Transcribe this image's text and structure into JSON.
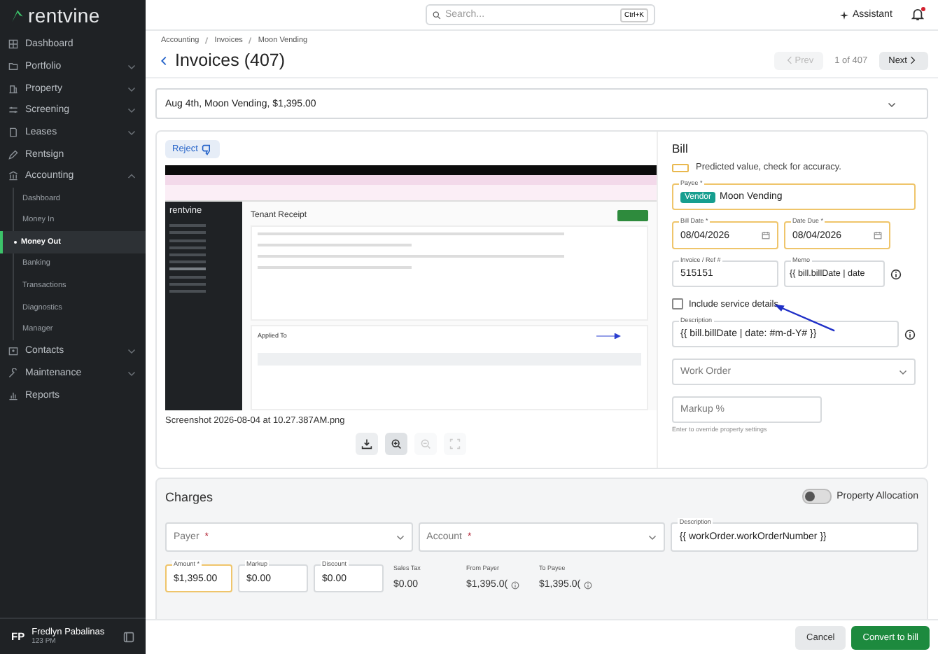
{
  "brand": {
    "name": "rentvine"
  },
  "sidebar": {
    "items": [
      {
        "label": "Dashboard",
        "kind": "link"
      },
      {
        "label": "Portfolio",
        "kind": "group",
        "expanded": false
      },
      {
        "label": "Property",
        "kind": "group",
        "expanded": false
      },
      {
        "label": "Screening",
        "kind": "group",
        "expanded": false
      },
      {
        "label": "Leases",
        "kind": "group",
        "expanded": false
      },
      {
        "label": "Rentsign",
        "kind": "link"
      },
      {
        "label": "Accounting",
        "kind": "group",
        "expanded": true,
        "children": [
          {
            "label": "Dashboard",
            "selected": false
          },
          {
            "label": "Money In",
            "selected": false
          },
          {
            "label": "Money Out",
            "selected": true
          },
          {
            "label": "Banking",
            "selected": false
          },
          {
            "label": "Transactions",
            "selected": false
          },
          {
            "label": "Diagnostics",
            "selected": false
          },
          {
            "label": "Manager",
            "selected": false
          }
        ]
      },
      {
        "label": "Contacts",
        "kind": "group",
        "expanded": false
      },
      {
        "label": "Maintenance",
        "kind": "group",
        "expanded": false
      },
      {
        "label": "Reports",
        "kind": "link"
      }
    ]
  },
  "user": {
    "initials": "FP",
    "name": "Fredlyn Pabalinas",
    "time": "123 PM"
  },
  "topbar": {
    "search_placeholder": "Search...",
    "shortcut": "Ctrl+K",
    "assistant": "Assistant",
    "notification": true
  },
  "breadcrumbs": [
    "Accounting",
    "Invoices",
    "Moon Vending"
  ],
  "page": {
    "title": "Invoices (407)",
    "prev": {
      "label": "Prev",
      "disabled": true
    },
    "counter": "1 of 407",
    "next": {
      "label": "Next",
      "disabled": false
    }
  },
  "invoice_select": {
    "value": "Aug 4th, Moon Vending, $1,395.00"
  },
  "attachment": {
    "reject": "Reject",
    "filename": "Screenshot 2026-08-04 at 10.27.387AM.png",
    "preview": {
      "logo": "rentvine",
      "title": "Tenant Receipt",
      "section": "Applied To"
    },
    "tools": [
      {
        "kind": "download",
        "disabled": false
      },
      {
        "kind": "zoom-in",
        "disabled": false
      },
      {
        "kind": "zoom-out",
        "disabled": true
      },
      {
        "kind": "fullscreen",
        "disabled": true
      }
    ]
  },
  "bill": {
    "title": "Bill",
    "legend": "Predicted value, check for accuracy.",
    "payee": {
      "label": "Payee *",
      "tag": "Vendor",
      "value": "Moon Vending",
      "predicted": true
    },
    "bill_date": {
      "label": "Bill Date *",
      "value": "08/04/2026",
      "predicted": true
    },
    "date_due": {
      "label": "Date Due *",
      "value": "08/04/2026",
      "predicted": true
    },
    "invoice_ref": {
      "label": "Invoice / Ref #",
      "value": "515151",
      "predicted": false
    },
    "memo": {
      "label": "Memo",
      "value": "{{ bill.billDate | date",
      "predicted": false
    },
    "include_service": {
      "label": "Include service details",
      "checked": false
    },
    "description": {
      "label": "Description",
      "value": "{{ bill.billDate | date: #m-d-Y# }}"
    },
    "work_order": {
      "placeholder": "Work Order"
    },
    "markup": {
      "placeholder": "Markup %",
      "hint": "Enter to override property settings"
    }
  },
  "charges": {
    "title": "Charges",
    "allocation": {
      "label": "Property Allocation",
      "on": false
    },
    "payer": {
      "placeholder": "Payer",
      "required_mark": "*"
    },
    "account": {
      "placeholder": "Account",
      "required_mark": "*"
    },
    "description": {
      "label": "Description",
      "value": "{{ workOrder.workOrderNumber }}"
    },
    "amount": {
      "label": "Amount *",
      "value": "$1,395.00",
      "predicted": true
    },
    "markup": {
      "label": "Markup",
      "value": "$0.00"
    },
    "discount": {
      "label": "Discount",
      "value": "$0.00"
    },
    "sales_tax": {
      "label": "Sales Tax",
      "value": "$0.00"
    },
    "from_payer": {
      "label": "From Payer",
      "value": "$1,395.0("
    },
    "to_payee": {
      "label": "To Payee",
      "value": "$1,395.0("
    }
  },
  "actions": {
    "cancel": "Cancel",
    "submit": "Convert to bill"
  }
}
